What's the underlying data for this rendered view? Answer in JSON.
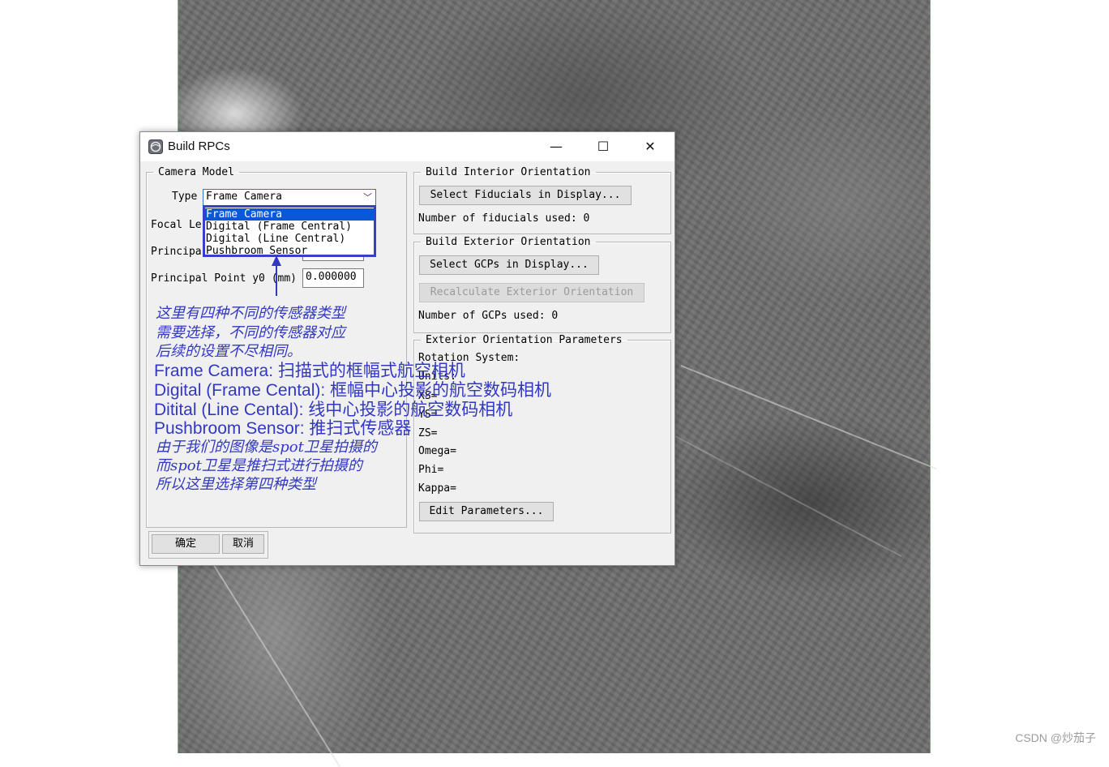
{
  "window": {
    "title": "Build RPCs",
    "icon": "envi-globe-icon",
    "controls": {
      "minimize": "—",
      "maximize": "☐",
      "close": "✕"
    }
  },
  "camera_model": {
    "legend": "Camera Model",
    "type_label": "Type",
    "type_value": "Frame Camera",
    "type_options": [
      "Frame Camera",
      "Digital (Frame Central)",
      "Digital (Line Central)",
      "Pushbroom Sensor"
    ],
    "selected_option_index": 0,
    "focal_length_label_partial": "Focal Le",
    "principal_x0_label_partial": "Principa",
    "principal_y0_label": "Principal Point y0 (mm)",
    "principal_y0_value": "0.000000"
  },
  "interior": {
    "legend": "Build Interior Orientation",
    "select_fiducials_button": "Select Fiducials in Display...",
    "fiducials_used": "Number of fiducials used: 0"
  },
  "exterior": {
    "legend": "Build Exterior Orientation",
    "select_gcps_button": "Select GCPs in Display...",
    "recalculate_button": "Recalculate Exterior Orientation",
    "gcps_used": "Number of GCPs used: 0"
  },
  "eo_params": {
    "legend": "Exterior Orientation Parameters",
    "rotation_system": "Rotation System:",
    "units": "Units:",
    "xs": "XS=",
    "ys": "YS=",
    "zs": "ZS=",
    "omega": "Omega=",
    "phi": "Phi=",
    "kappa": "Kappa=",
    "edit_button": "Edit Parameters..."
  },
  "footer": {
    "ok": "确定",
    "cancel": "取消"
  },
  "annotation": {
    "line1": "这里有四种不同的传感器类型",
    "line2": "需要选择，不同的传感器对应",
    "line3": "后续的设置不尽相同。",
    "line4": "Frame Camera: 扫描式的框幅式航空相机",
    "line5": "Digital (Frame Cental): 框幅中心投影的航空数码相机",
    "line6": "Ditital (Line Cental): 线中心投影的航空数码相机",
    "line7": "Pushbroom Sensor: 推扫式传感器",
    "line8": "由于我们的图像是spot卫星拍摄的",
    "line9": "而spot卫星是推扫式进行拍摄的",
    "line10": "所以这里选择第四种类型",
    "color": "#3238c2"
  },
  "watermark": "CSDN @炒茄子"
}
